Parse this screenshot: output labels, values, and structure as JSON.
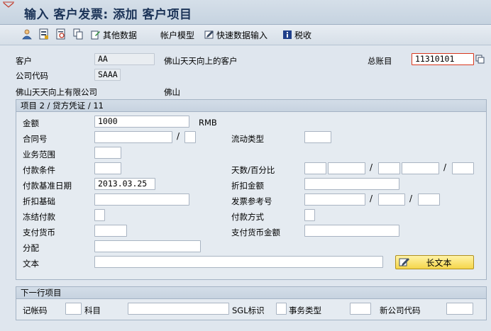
{
  "window": {
    "title": "输入 客户发票: 添加 客户项目"
  },
  "toolbar": {
    "other_data_label": "其他数据",
    "account_model_label": "帐户模型",
    "fast_data_entry_label": "快速数据输入",
    "tax_label": "税收"
  },
  "header": {
    "customer_label": "客户",
    "customer_value": "AA",
    "customer_name": "佛山天天向上的客户",
    "gl_account_label": "总账目",
    "gl_account_value": "11310101",
    "company_code_label": "公司代码",
    "company_code_value": "SAAA",
    "company_name": "佛山天天向上有限公司",
    "city": "佛山"
  },
  "item": {
    "section_title": "项目 2 / 贷方凭证 / 11",
    "amount_label": "金额",
    "amount_value": "1000",
    "currency": "RMB",
    "contract_label": "合同号",
    "contract_value": "",
    "contract_type_value": "",
    "flow_type_label": "流动类型",
    "flow_type_value": "",
    "business_area_label": "业务范围",
    "business_area_value": "",
    "payment_terms_label": "付款条件",
    "payment_terms_value": "",
    "days_pct_label": "天数/百分比",
    "baseline_date_label": "付款基准日期",
    "baseline_date_value": "2013.03.25",
    "discount_amount_label": "折扣金额",
    "discount_base_label": "折扣基础",
    "invoice_ref_label": "发票参考号",
    "payment_block_label": "冻结付款",
    "payment_method_label": "付款方式",
    "payment_currency_label": "支付货币",
    "payment_currency_amount_label": "支付货币金额",
    "assignment_label": "分配",
    "text_label": "文本",
    "long_text_button": "长文本"
  },
  "next_item": {
    "section_title": "下一行项目",
    "posting_key_label": "记帐码",
    "account_label": "科目",
    "sgl_label": "SGL标识",
    "transaction_type_label": "事务类型",
    "new_company_code_label": "新公司代码"
  },
  "colors": {
    "background": "#dfe6ee",
    "title_text": "#1b3357",
    "required_border": "#d9381e",
    "long_text_button": "#f5d64a"
  }
}
